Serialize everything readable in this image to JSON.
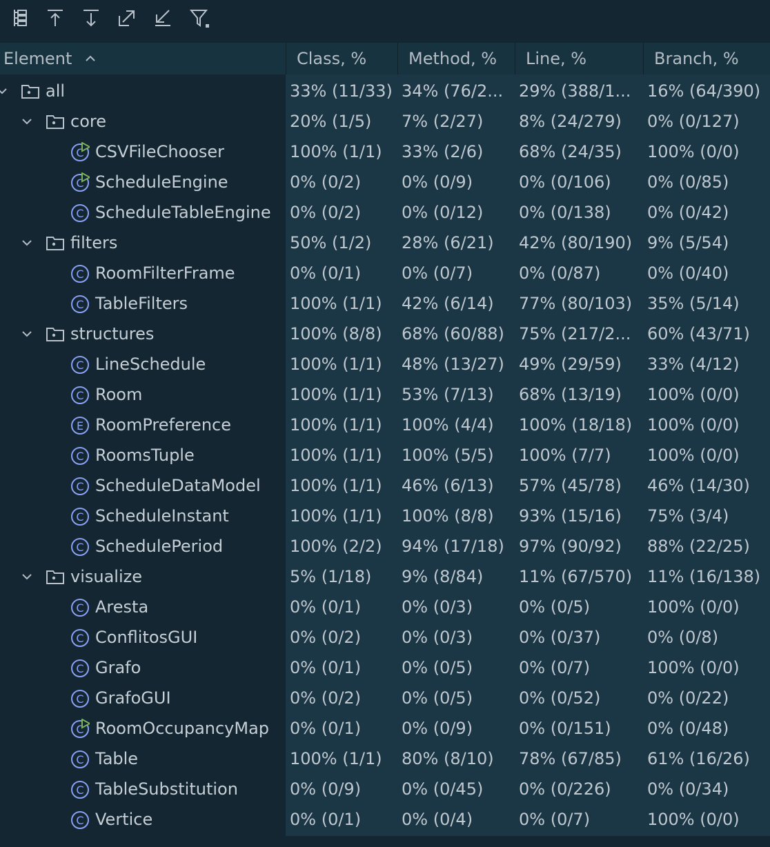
{
  "toolbar": {
    "buttons": [
      {
        "icon": "tree-structure-icon"
      },
      {
        "icon": "scroll-from-source-icon"
      },
      {
        "icon": "scroll-to-source-icon"
      },
      {
        "icon": "expand-all-icon"
      },
      {
        "icon": "collapse-all-icon"
      },
      {
        "icon": "filter-icon"
      }
    ]
  },
  "columns": {
    "element": "Element",
    "class": "Class, %",
    "method": "Method, %",
    "line": "Line, %",
    "branch": "Branch, %"
  },
  "sort_indicator": "ascending",
  "colors": {
    "background": "#132631",
    "data_background": "#1b3745",
    "class_icon": "#8aa1f5",
    "run_marker": "#7ab35c"
  },
  "rows": [
    {
      "name": "all",
      "type": "package",
      "level": 0,
      "expanded": true,
      "class": "33% (11/33)",
      "method": "34% (76/2...",
      "line": "29% (388/1...",
      "branch": "16% (64/390)"
    },
    {
      "name": "core",
      "type": "package",
      "level": 1,
      "expanded": true,
      "class": "20% (1/5)",
      "method": "7% (2/27)",
      "line": "8% (24/279)",
      "branch": "0% (0/127)"
    },
    {
      "name": "CSVFileChooser",
      "type": "runnable-class",
      "level": 2,
      "class": "100% (1/1)",
      "method": "33% (2/6)",
      "line": "68% (24/35)",
      "branch": "100% (0/0)"
    },
    {
      "name": "ScheduleEngine",
      "type": "runnable-class",
      "level": 2,
      "class": "0% (0/2)",
      "method": "0% (0/9)",
      "line": "0% (0/106)",
      "branch": "0% (0/85)"
    },
    {
      "name": "ScheduleTableEngine",
      "type": "class",
      "level": 2,
      "class": "0% (0/2)",
      "method": "0% (0/12)",
      "line": "0% (0/138)",
      "branch": "0% (0/42)"
    },
    {
      "name": "filters",
      "type": "package",
      "level": 1,
      "expanded": true,
      "class": "50% (1/2)",
      "method": "28% (6/21)",
      "line": "42% (80/190)",
      "branch": "9% (5/54)"
    },
    {
      "name": "RoomFilterFrame",
      "type": "class",
      "level": 2,
      "class": "0% (0/1)",
      "method": "0% (0/7)",
      "line": "0% (0/87)",
      "branch": "0% (0/40)"
    },
    {
      "name": "TableFilters",
      "type": "class",
      "level": 2,
      "class": "100% (1/1)",
      "method": "42% (6/14)",
      "line": "77% (80/103)",
      "branch": "35% (5/14)"
    },
    {
      "name": "structures",
      "type": "package",
      "level": 1,
      "expanded": true,
      "class": "100% (8/8)",
      "method": "68% (60/88)",
      "line": "75% (217/2...",
      "branch": "60% (43/71)"
    },
    {
      "name": "LineSchedule",
      "type": "class",
      "level": 2,
      "class": "100% (1/1)",
      "method": "48% (13/27)",
      "line": "49% (29/59)",
      "branch": "33% (4/12)"
    },
    {
      "name": "Room",
      "type": "class",
      "level": 2,
      "class": "100% (1/1)",
      "method": "53% (7/13)",
      "line": "68% (13/19)",
      "branch": "100% (0/0)"
    },
    {
      "name": "RoomPreference",
      "type": "enum",
      "level": 2,
      "class": "100% (1/1)",
      "method": "100% (4/4)",
      "line": "100% (18/18)",
      "branch": "100% (0/0)"
    },
    {
      "name": "RoomsTuple",
      "type": "class",
      "level": 2,
      "class": "100% (1/1)",
      "method": "100% (5/5)",
      "line": "100% (7/7)",
      "branch": "100% (0/0)"
    },
    {
      "name": "ScheduleDataModel",
      "type": "class",
      "level": 2,
      "class": "100% (1/1)",
      "method": "46% (6/13)",
      "line": "57% (45/78)",
      "branch": "46% (14/30)"
    },
    {
      "name": "ScheduleInstant",
      "type": "class",
      "level": 2,
      "class": "100% (1/1)",
      "method": "100% (8/8)",
      "line": "93% (15/16)",
      "branch": "75% (3/4)"
    },
    {
      "name": "SchedulePeriod",
      "type": "class",
      "level": 2,
      "class": "100% (2/2)",
      "method": "94% (17/18)",
      "line": "97% (90/92)",
      "branch": "88% (22/25)"
    },
    {
      "name": "visualize",
      "type": "package",
      "level": 1,
      "expanded": true,
      "class": "5% (1/18)",
      "method": "9% (8/84)",
      "line": "11% (67/570)",
      "branch": "11% (16/138)"
    },
    {
      "name": "Aresta",
      "type": "class",
      "level": 2,
      "class": "0% (0/1)",
      "method": "0% (0/3)",
      "line": "0% (0/5)",
      "branch": "100% (0/0)"
    },
    {
      "name": "ConflitosGUI",
      "type": "class",
      "level": 2,
      "class": "0% (0/2)",
      "method": "0% (0/3)",
      "line": "0% (0/37)",
      "branch": "0% (0/8)"
    },
    {
      "name": "Grafo",
      "type": "class",
      "level": 2,
      "class": "0% (0/1)",
      "method": "0% (0/5)",
      "line": "0% (0/7)",
      "branch": "100% (0/0)"
    },
    {
      "name": "GrafoGUI",
      "type": "class",
      "level": 2,
      "class": "0% (0/2)",
      "method": "0% (0/5)",
      "line": "0% (0/52)",
      "branch": "0% (0/22)"
    },
    {
      "name": "RoomOccupancyMap",
      "type": "runnable-class",
      "level": 2,
      "class": "0% (0/1)",
      "method": "0% (0/9)",
      "line": "0% (0/151)",
      "branch": "0% (0/48)"
    },
    {
      "name": "Table",
      "type": "class",
      "level": 2,
      "class": "100% (1/1)",
      "method": "80% (8/10)",
      "line": "78% (67/85)",
      "branch": "61% (16/26)"
    },
    {
      "name": "TableSubstitution",
      "type": "class",
      "level": 2,
      "class": "0% (0/9)",
      "method": "0% (0/45)",
      "line": "0% (0/226)",
      "branch": "0% (0/34)"
    },
    {
      "name": "Vertice",
      "type": "class",
      "level": 2,
      "class": "0% (0/1)",
      "method": "0% (0/4)",
      "line": "0% (0/7)",
      "branch": "100% (0/0)"
    }
  ]
}
